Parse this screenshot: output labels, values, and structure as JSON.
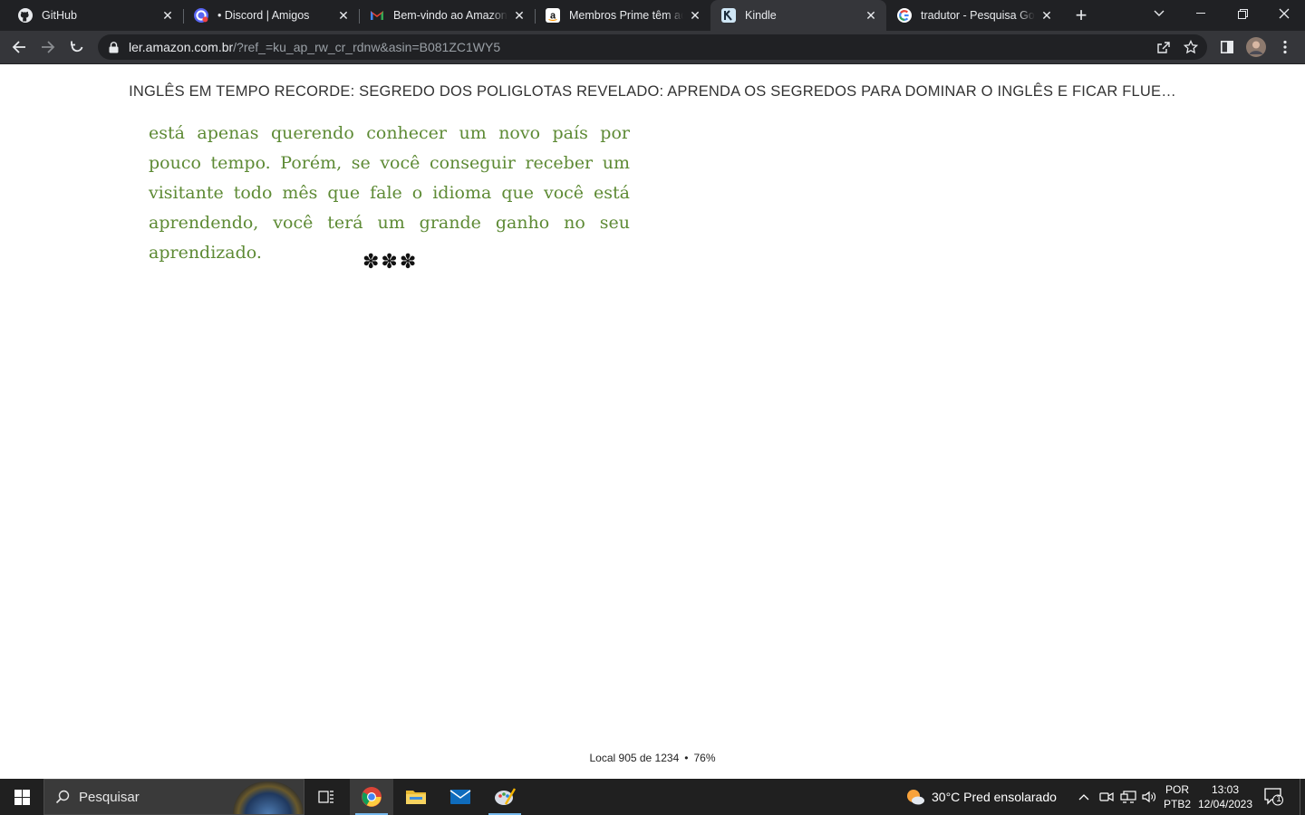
{
  "browser": {
    "tabs": [
      {
        "title": "GitHub",
        "icon": "github-icon",
        "active": false
      },
      {
        "title": "• Discord | Amigos",
        "icon": "discord-icon",
        "active": false
      },
      {
        "title": "Bem-vindo ao Amazon Prime",
        "icon": "gmail-icon",
        "active": false
      },
      {
        "title": "Membros Prime têm acesso",
        "icon": "amazon-icon",
        "active": false
      },
      {
        "title": "Kindle",
        "icon": "kindle-icon",
        "active": true
      },
      {
        "title": "tradutor - Pesquisa Google",
        "icon": "google-icon",
        "active": false
      }
    ],
    "url": {
      "domain": "ler.amazon.com.br",
      "path": "/?ref_=ku_ap_rw_cr_rdnw&asin=B081ZC1WY5"
    }
  },
  "reader": {
    "book_title": "INGLÊS EM TEMPO RECORDE: SEGREDO DOS POLIGLOTAS REVELADO: APRENDA OS SEGREDOS PARA DOMINAR O INGLÊS E FICAR FLUE…",
    "paragraph": "está apenas querendo conhecer um novo país por pouco tempo. Porém, se você conseguir receber um visitante todo mês que fale o idioma que você está aprendendo, você terá um grande ganho no seu aprendizado.",
    "separator": "✽✽✽",
    "location": "Local 905 de 1234",
    "progress_dot": "•",
    "progress_percent": "76%",
    "text_color": "#5d8a34"
  },
  "taskbar": {
    "search_placeholder": "Pesquisar",
    "weather": "30°C  Pred ensolarado",
    "lang_top": "POR",
    "lang_bottom": "PTB2",
    "time": "13:03",
    "date": "12/04/2023",
    "notification_count": "1"
  }
}
